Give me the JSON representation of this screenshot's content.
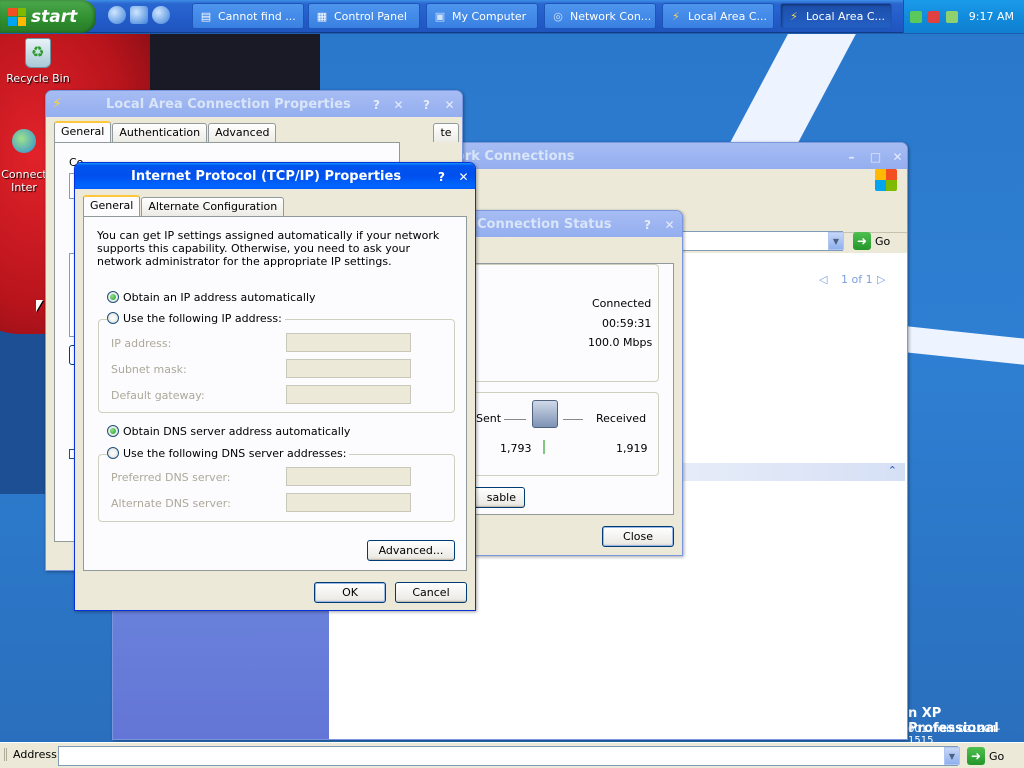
{
  "taskbar": {
    "start_label": "start",
    "buttons": [
      {
        "label": "Cannot find ..."
      },
      {
        "label": "Control Panel"
      },
      {
        "label": "My Computer"
      },
      {
        "label": "Network Con..."
      },
      {
        "label": "Local Area C..."
      },
      {
        "label": "Local Area C..."
      }
    ],
    "clock": "9:17 AM"
  },
  "desktop": {
    "icons": [
      {
        "label": "Recycle Bin"
      },
      {
        "label": "Connect\nInter"
      }
    ],
    "watermark_line1": "n XP Professional",
    "watermark_line2": "001.main.021204-1515"
  },
  "local_area_props": {
    "title": "Local Area Connection Properties",
    "tabs": [
      "General",
      "Authentication",
      "Advanced"
    ],
    "hidden_tab_fragment": "te",
    "help": "?",
    "close": "✕",
    "conn_label_fragment": "Co"
  },
  "network_connections": {
    "title": "Network Connections",
    "go_label": "Go",
    "pager": "1 of 1"
  },
  "connection_status": {
    "title": "Connection Status",
    "status_value": "Connected",
    "duration_value": "00:59:31",
    "speed_value": "100.0 Mbps",
    "sent_label": "Sent",
    "received_label": "Received",
    "sent_value": "1,793",
    "received_value": "1,919",
    "disable_fragment": "sable",
    "close_button": "Close"
  },
  "tcpip": {
    "title": "Internet Protocol (TCP/IP) Properties",
    "tabs": [
      "General",
      "Alternate Configuration"
    ],
    "description": "You can get IP settings assigned automatically if your network supports this capability. Otherwise, you need to ask your network administrator for the appropriate IP settings.",
    "obtain_ip": "Obtain an IP address automatically",
    "use_ip": "Use the following IP address:",
    "ip_address": "IP address:",
    "subnet_mask": "Subnet mask:",
    "default_gateway": "Default gateway:",
    "obtain_dns": "Obtain DNS server address automatically",
    "use_dns": "Use the following DNS server addresses:",
    "preferred_dns": "Preferred DNS server:",
    "alternate_dns": "Alternate DNS server:",
    "advanced_button": "Advanced...",
    "ok_button": "OK",
    "cancel_button": "Cancel",
    "help": "?",
    "close": "✕"
  },
  "address_bar": {
    "label": "Address",
    "go_label": "Go"
  }
}
